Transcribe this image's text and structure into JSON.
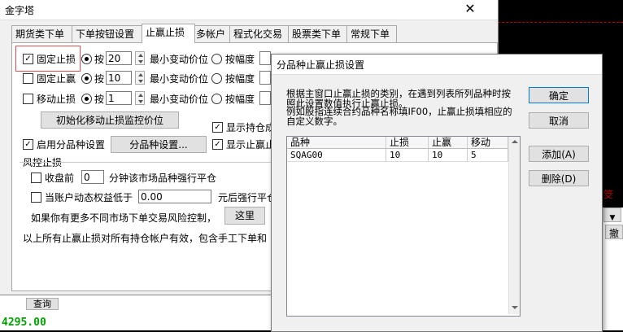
{
  "colors": {
    "price": "#00c000",
    "accent_red": "#c00000",
    "highlight": "#e05050"
  },
  "main_window": {
    "title": "金字塔",
    "close_glyph": "✕",
    "tabs": [
      "期货类下单",
      "下单按钮设置",
      "止赢止损",
      "多帐户",
      "程式化交易",
      "股票类下单",
      "常规下单"
    ],
    "active_tab": 2,
    "rows": [
      {
        "label": "固定止损",
        "checked": true,
        "by": "按",
        "value": "20",
        "min_label": "最小变动价位",
        "pct_label": "按幅度"
      },
      {
        "label": "固定止赢",
        "checked": false,
        "by": "按",
        "value": "10",
        "min_label": "最小变动价位",
        "pct_label": "按幅度"
      },
      {
        "label": "移动止损",
        "checked": false,
        "by": "按",
        "value": "1",
        "min_label": "最小变动价位",
        "pct_label": "按幅度"
      }
    ],
    "init_button": "初始化移动止损监控价位",
    "show_pos": "显示持仓成",
    "enable_variety": "启用分品种设置",
    "variety_button": "分品种设置...",
    "show_stop": "显示止赢止",
    "risk_title": "风控止损",
    "close_before": "收盘前",
    "close_minutes": "0",
    "close_after": "分钟该市场品种强行平仓",
    "equity_label": "当账户动态权益低于",
    "equity_value": "0.00",
    "equity_after": "元后强行平仓",
    "more_text": "如果你有更多不同市场下单交易风险控制，",
    "here_button": "这里",
    "footer_text": "以上所有止赢止损对所有持仓帐户有效，包含手工下单和"
  },
  "sub_dialog": {
    "title": "分品种止赢止损设置",
    "description": [
      "根据主窗口止赢止损的类别，在遇到列表所列品种时按",
      "照此设置数值执行止赢止损。",
      "例如股指连续合约品种名称填IF00，止赢止损填相应的",
      "自定义数字。"
    ],
    "columns": [
      "品种",
      "止损",
      "止赢",
      "移动"
    ],
    "rows": [
      [
        "SQAG00",
        "10",
        "10",
        "5"
      ]
    ],
    "ok": "确定",
    "cancel": "取消",
    "add": "添加(A)",
    "delete": "删除(D)"
  },
  "background": {
    "query_button": "查询",
    "price": "4295.00",
    "side_label": "撤",
    "red_text": "筊"
  }
}
